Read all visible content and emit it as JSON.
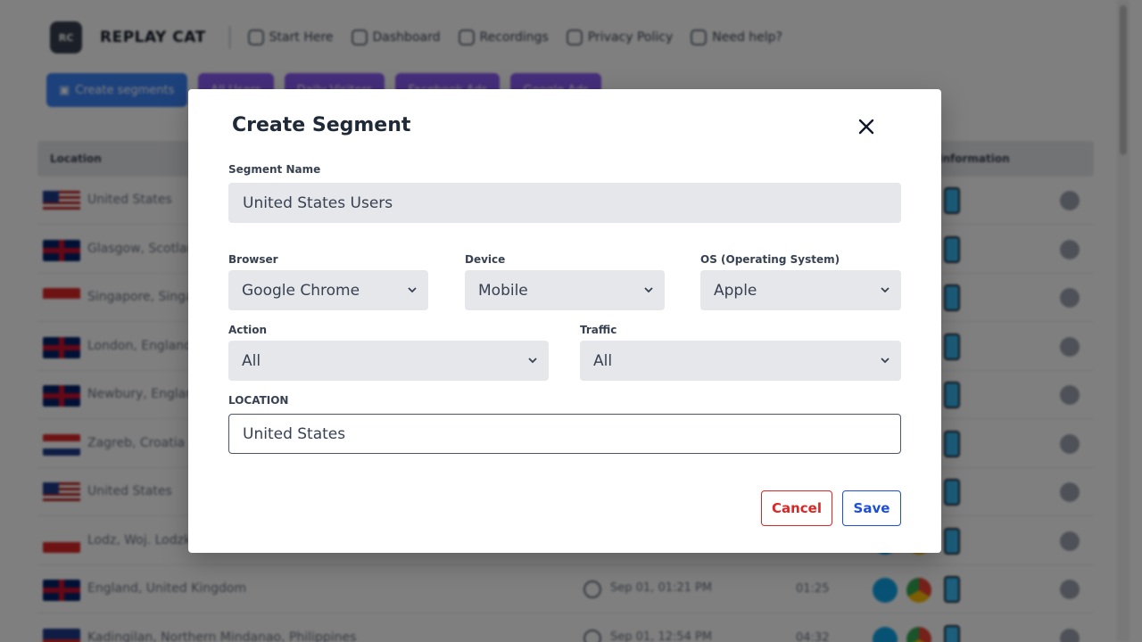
{
  "app": {
    "logo_text": "RC",
    "brand": "REPLAY CAT",
    "nav": [
      {
        "label": "Start Here",
        "icon": "rocket-icon"
      },
      {
        "label": "Dashboard",
        "icon": "shield-icon"
      },
      {
        "label": "Recordings",
        "icon": "video-icon"
      },
      {
        "label": "Privacy Policy",
        "icon": "lock-icon"
      },
      {
        "label": "Need help?",
        "icon": "mail-icon"
      }
    ],
    "create_segments_label": "Create segments",
    "segment_pills": [
      "All Users",
      "Daily Visitors",
      "Facebook Ads",
      "Google Ads"
    ],
    "table": {
      "col_location": "Location",
      "col_information": "Information",
      "rows": [
        {
          "flag": "us",
          "location": "United States",
          "time": "",
          "duration": ""
        },
        {
          "flag": "uk",
          "location": "Glasgow, Scotland",
          "time": "",
          "duration": ""
        },
        {
          "flag": "sg",
          "location": "Singapore, Singapore",
          "time": "",
          "duration": ""
        },
        {
          "flag": "uk",
          "location": "London, England",
          "time": "",
          "duration": ""
        },
        {
          "flag": "uk",
          "location": "Newbury, England",
          "time": "",
          "duration": ""
        },
        {
          "flag": "hr",
          "location": "Zagreb, Croatia",
          "time": "",
          "duration": ""
        },
        {
          "flag": "us",
          "location": "United States",
          "time": "",
          "duration": ""
        },
        {
          "flag": "pl",
          "location": "Lodz, Woj. Lodzkie",
          "time": "",
          "duration": ""
        },
        {
          "flag": "uk",
          "location": "England, United Kingdom",
          "time": "Sep 01, 01:21 PM",
          "duration": "01:25"
        },
        {
          "flag": "ph",
          "location": "Kadingilan, Northern Mindanao, Philippines",
          "time": "Sep 01, 12:54 PM",
          "duration": "04:32"
        }
      ]
    }
  },
  "modal": {
    "title": "Create Segment",
    "segment_name": {
      "label": "Segment Name",
      "value": "United States Users"
    },
    "browser": {
      "label": "Browser",
      "value": "Google Chrome"
    },
    "device": {
      "label": "Device",
      "value": "Mobile"
    },
    "os": {
      "label": "OS (Operating System)",
      "value": "Apple"
    },
    "action": {
      "label": "Action",
      "value": "All"
    },
    "traffic": {
      "label": "Traffic",
      "value": "All"
    },
    "location": {
      "label": "LOCATION",
      "value": "United States"
    },
    "cancel_label": "Cancel",
    "save_label": "Save"
  },
  "colors": {
    "cancel": "#dc2626",
    "save": "#1d4ed8",
    "create_segments": "#3b82f6",
    "segment_pill": "#8b5cf6"
  }
}
